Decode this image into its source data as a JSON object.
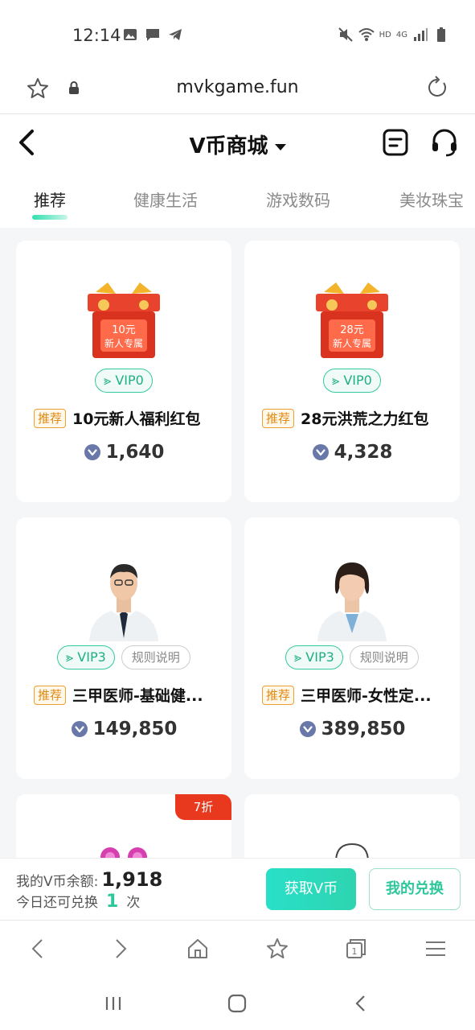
{
  "status_bar": {
    "time": "12:14",
    "network": "4G",
    "hd": "HD"
  },
  "browser": {
    "url": "mvkgame.fun"
  },
  "header": {
    "title": "V币商城"
  },
  "tabs": [
    {
      "label": "推荐",
      "active": true
    },
    {
      "label": "健康生活",
      "active": false
    },
    {
      "label": "游戏数码",
      "active": false
    },
    {
      "label": "美妆珠宝",
      "active": false
    }
  ],
  "products": [
    {
      "image_label_line1": "10元",
      "image_label_line2": "新人专属",
      "vip": "VIP0",
      "tag": "推荐",
      "title": "10元新人福利红包",
      "price": "1,640"
    },
    {
      "image_label_line1": "28元",
      "image_label_line2": "新人专属",
      "vip": "VIP0",
      "tag": "推荐",
      "title": "28元洪荒之力红包",
      "price": "4,328"
    },
    {
      "vip": "VIP3",
      "rules": "规则说明",
      "tag": "推荐",
      "title": "三甲医师-基础健...",
      "price": "149,850"
    },
    {
      "vip": "VIP3",
      "rules": "规则说明",
      "tag": "推荐",
      "title": "三甲医师-女性定...",
      "price": "389,850"
    },
    {
      "discount": "7折"
    },
    {}
  ],
  "balance": {
    "label": "我的V币余额:",
    "value": "1,918",
    "remain_prefix": "今日还可兑换",
    "remain_value": "1",
    "remain_suffix": "次"
  },
  "buttons": {
    "get_coins": "获取V币",
    "my_exchange": "我的兑换"
  },
  "colors": {
    "accent": "#2ec79b",
    "discount": "#e8391f",
    "recommend_tag": "#e08a10"
  }
}
